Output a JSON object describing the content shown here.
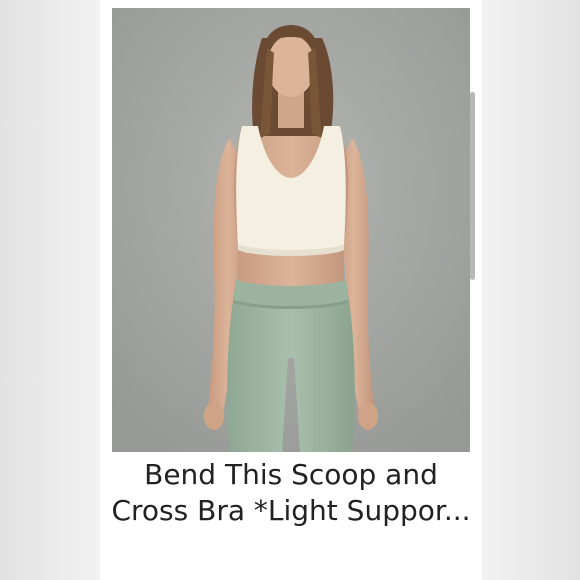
{
  "product": {
    "title_line1": "Bend This Scoop and",
    "title_line2": "Cross Bra *Light Suppor...",
    "image_icon": "product-photo"
  },
  "colors": {
    "photo_background": "#a3a5a2",
    "top_color": "#f4efe1",
    "leggings_color": "#9fb6a3",
    "card_background": "#ffffff"
  }
}
